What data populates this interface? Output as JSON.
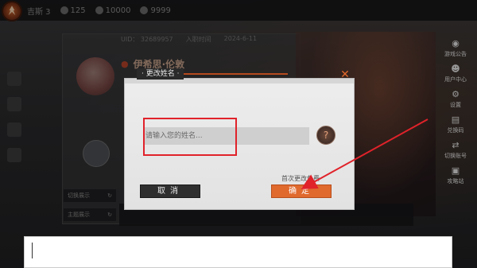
{
  "topbar": {
    "stats": [
      "吉斯 3",
      "125",
      "10000",
      "9999"
    ]
  },
  "profile": {
    "uid_text": "UID： 32689957",
    "join_date_label": "入职时间",
    "join_date": "2024-6-11",
    "character_name": "伊希思·伦敦",
    "side_buttons": [
      "切换展示",
      "主题展示"
    ]
  },
  "right_menu": {
    "items": [
      {
        "label": "游戏公告",
        "icon": "announcement-icon"
      },
      {
        "label": "用户中心",
        "icon": "user-center-icon"
      },
      {
        "label": "设置",
        "icon": "gear-icon"
      },
      {
        "label": "兑换码",
        "icon": "redeem-icon"
      },
      {
        "label": "切换账号",
        "icon": "switch-account-icon"
      },
      {
        "label": "攻略站",
        "icon": "guide-icon"
      }
    ]
  },
  "modal": {
    "title": "· 更改姓名 ·",
    "input_placeholder": "请输入您的姓名...",
    "input_value": "",
    "cancel_label": "取消",
    "confirm_label": "确定",
    "free_note": "首次更改免费",
    "close_glyph": "✕",
    "random_glyph": "?"
  },
  "annotation": {
    "highlight_color": "#e0222a",
    "arrow_color": "#e0222a"
  },
  "colors": {
    "accent": "#e0692d"
  }
}
